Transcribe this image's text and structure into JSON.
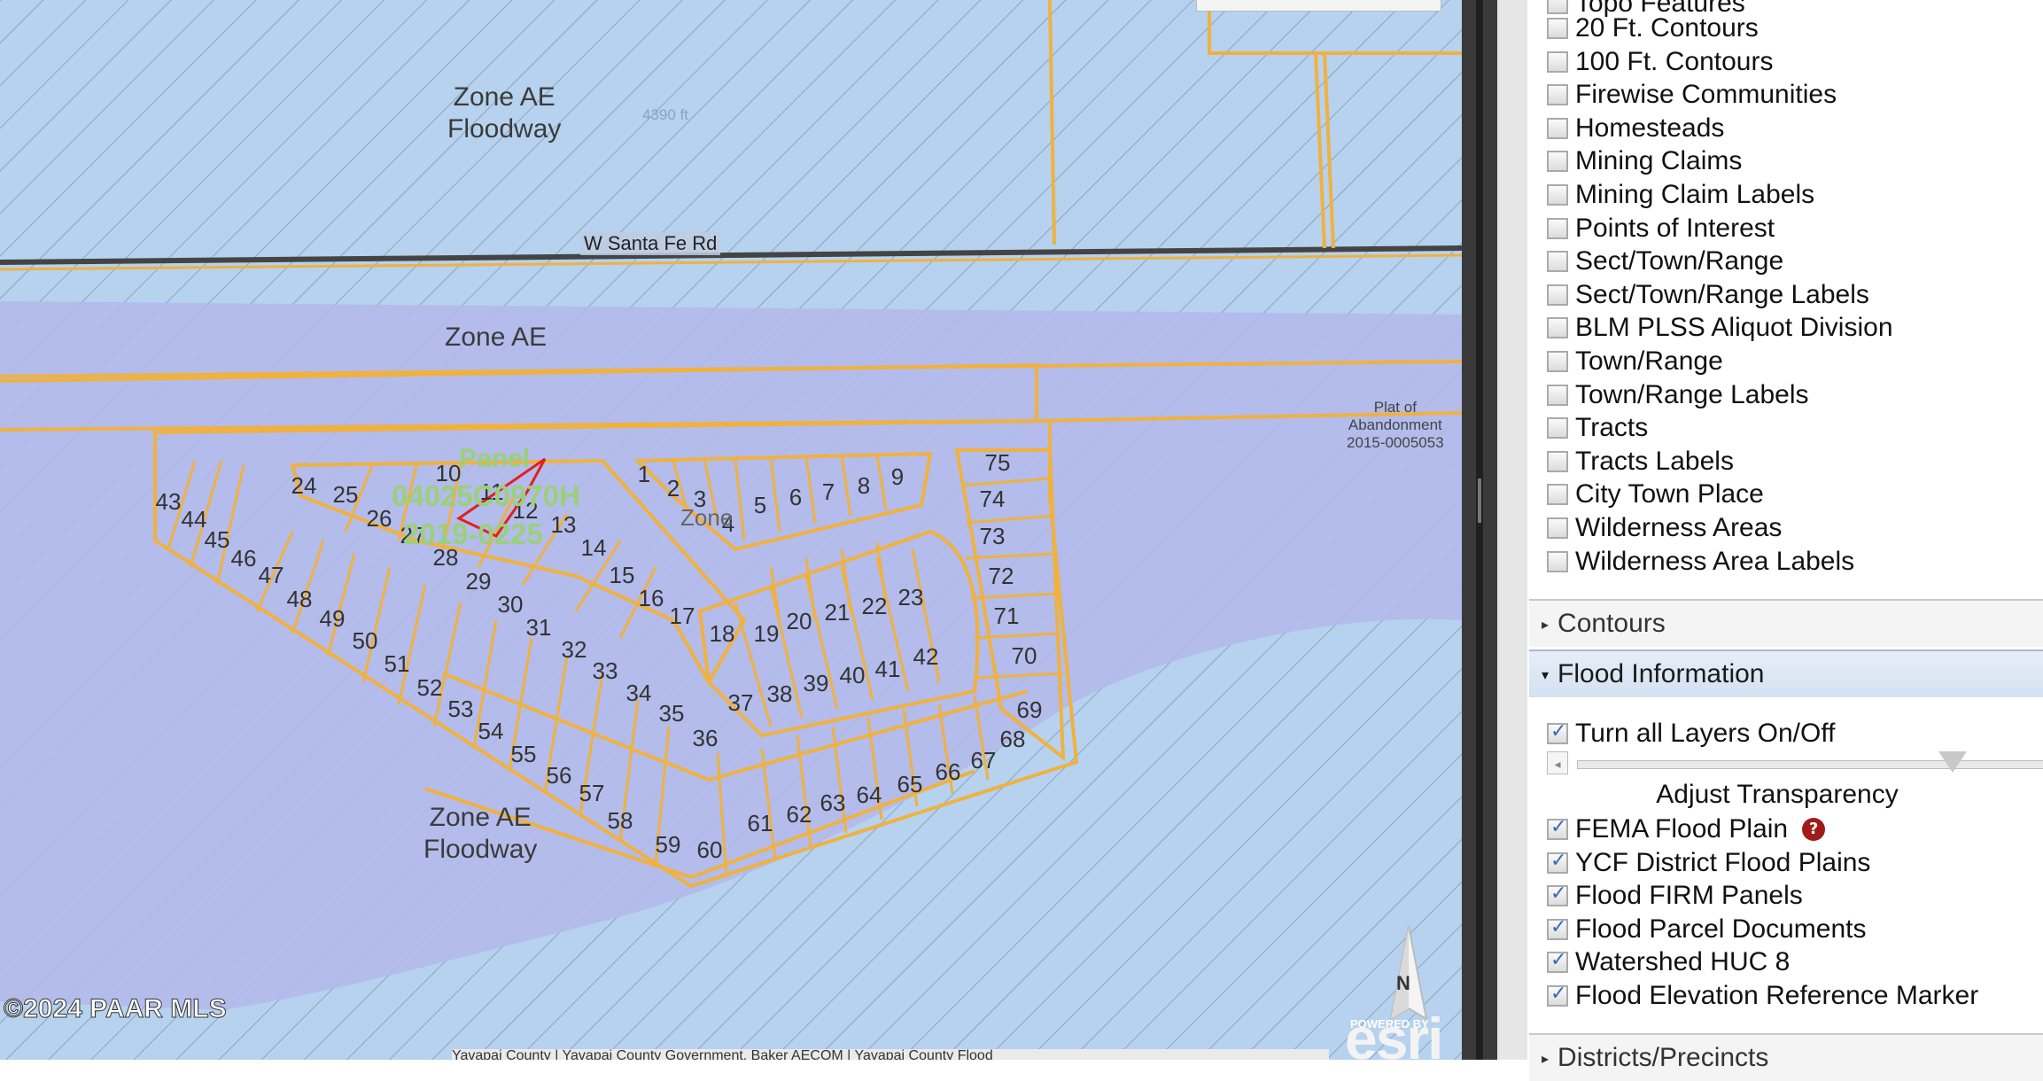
{
  "map": {
    "zone_labels": [
      {
        "line1": "Zone AE",
        "line2": "Floodway"
      },
      {
        "line1": "Zone AE",
        "line2": ""
      },
      {
        "line1": "Zone AE",
        "line2": "Floodway"
      }
    ],
    "road_label": "W Santa Fe Rd",
    "elevation_label": "4390 ft",
    "plat_label": [
      "Plat of",
      "Abandonment",
      "2015-0005053"
    ],
    "panel_label": "Panel",
    "panel_id": "04025C0970H",
    "doc_number": "2019-0225",
    "zone_inline": "Zone",
    "lot_numbers": [
      "1",
      "2",
      "3",
      "4",
      "5",
      "6",
      "7",
      "8",
      "9",
      "10",
      "11",
      "12",
      "13",
      "14",
      "15",
      "16",
      "17",
      "18",
      "19",
      "20",
      "21",
      "22",
      "23",
      "24",
      "25",
      "26",
      "27",
      "28",
      "29",
      "30",
      "31",
      "32",
      "33",
      "34",
      "35",
      "36",
      "37",
      "38",
      "39",
      "40",
      "41",
      "42",
      "43",
      "44",
      "45",
      "46",
      "47",
      "48",
      "49",
      "50",
      "51",
      "52",
      "53",
      "54",
      "55",
      "56",
      "57",
      "58",
      "59",
      "60",
      "61",
      "62",
      "63",
      "64",
      "65",
      "66",
      "67",
      "68",
      "69",
      "70",
      "71",
      "72",
      "73",
      "74",
      "75"
    ],
    "copyright": "©2024 PAAR MLS",
    "attribution": "Yavapai County | Yavapai County Government, Baker AECOM | Yavapai County Flood",
    "north_label": "N",
    "esri_powered": "POWERED BY",
    "esri_logo": "esri",
    "colors": {
      "floodway": "#b6d2ee",
      "zone_ae": "#b3b8ea",
      "parcel": "#f0b13f",
      "selected": "#e02020"
    }
  },
  "panel": {
    "partial_top_item": "Topo Features",
    "topo_layers": [
      {
        "label": "20 Ft. Contours",
        "checked": false
      },
      {
        "label": "100 Ft. Contours",
        "checked": false
      },
      {
        "label": "Firewise Communities",
        "checked": false
      },
      {
        "label": "Homesteads",
        "checked": false
      },
      {
        "label": "Mining Claims",
        "checked": false
      },
      {
        "label": "Mining Claim Labels",
        "checked": false
      },
      {
        "label": "Points of Interest",
        "checked": false
      },
      {
        "label": "Sect/Town/Range",
        "checked": false
      },
      {
        "label": "Sect/Town/Range Labels",
        "checked": false
      },
      {
        "label": "BLM PLSS Aliquot Division",
        "checked": false
      },
      {
        "label": "Town/Range",
        "checked": false
      },
      {
        "label": "Town/Range Labels",
        "checked": false
      },
      {
        "label": "Tracts",
        "checked": false
      },
      {
        "label": "Tracts Labels",
        "checked": false
      },
      {
        "label": "City Town Place",
        "checked": false
      },
      {
        "label": "Wilderness Areas",
        "checked": false
      },
      {
        "label": "Wilderness Area Labels",
        "checked": false
      }
    ],
    "sections": {
      "contours": "Contours",
      "flood": "Flood Information",
      "districts": "Districts/Precincts"
    },
    "toggle_all": "Turn all Layers On/Off",
    "transparency_label": "Adjust Transparency",
    "transparency_level": 0.8,
    "flood_layers": [
      {
        "label": "FEMA Flood Plain",
        "checked": true,
        "help": "?"
      },
      {
        "label": "YCF District Flood Plains",
        "checked": true
      },
      {
        "label": "Flood FIRM Panels",
        "checked": true
      },
      {
        "label": "Flood Parcel Documents",
        "checked": true
      },
      {
        "label": "Watershed HUC 8",
        "checked": true
      },
      {
        "label": "Flood Elevation Reference Marker",
        "checked": true
      }
    ]
  }
}
